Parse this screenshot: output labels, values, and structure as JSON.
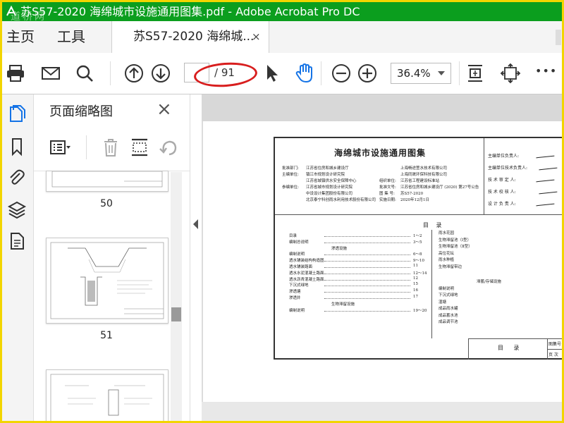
{
  "window": {
    "title": "苏S57-2020 海绵城市设施通用图集.pdf - Adobe Acrobat Pro DC",
    "watermark": "道桥网"
  },
  "tabs": {
    "home": "主页",
    "tools": "工具",
    "document": "苏S57-2020 海绵城...",
    "close": "×"
  },
  "toolbar": {
    "current_page": "",
    "page_count": "/ 91",
    "zoom": "36.4%",
    "more": "•••"
  },
  "thumbnail_panel": {
    "title": "页面缩略图",
    "close": "×",
    "thumbnails": [
      {
        "label": "50"
      },
      {
        "label": "51"
      }
    ]
  },
  "document_page": {
    "title": "海绵城市设施通用图集",
    "info_left": [
      {
        "k": "批准部门:",
        "v": "江苏省住房和城乡建设厅"
      },
      {
        "k": "主编单位:",
        "v": "镇江市规划设计研究院"
      },
      {
        "k": "",
        "v": "江苏省城镇供水安全保障中心"
      },
      {
        "k": "参编单位:",
        "v": "江苏省城市规划设计研究院"
      },
      {
        "k": "",
        "v": "中设设计集团股份有限公司"
      },
      {
        "k": "",
        "v": "北京泰宁科创雨水利用技术股份有限公司"
      }
    ],
    "info_mid": [
      {
        "k": "",
        "v": "上海畅途萱水技术有限公司"
      },
      {
        "k": "",
        "v": "上海同晟环保科技有限公司"
      },
      {
        "k": "组织单位:",
        "v": "江苏省工程建设标准站"
      },
      {
        "k": "批准文号:",
        "v": "江苏省住房和城乡建设厅 (2020) 第27号公告"
      },
      {
        "k": "图 集 号:",
        "v": "苏S57-2020"
      },
      {
        "k": "实施日期:",
        "v": "2020年12月1日"
      }
    ],
    "signatures": [
      "主编单位负责人:",
      "主编单位技术负责人:",
      "技 术 审 定 人:",
      "技 术 校 核 人:",
      "设 计 负 责 人:"
    ],
    "toc_heading": "目 录",
    "toc_left": [
      {
        "t": "目录",
        "p": "1～2"
      },
      {
        "t": "编制总说明",
        "p": "3～5"
      },
      {
        "t": "渗透设施",
        "p": ""
      },
      {
        "t": "编制说明",
        "p": "6～8"
      },
      {
        "t": "透水铺装结构构造图",
        "p": "9～10"
      },
      {
        "t": "透水铺装路面",
        "p": "11"
      },
      {
        "t": "透水水泥混凝土路面",
        "p": "12～14"
      },
      {
        "t": "透水沥青混凝土路面",
        "p": "12"
      },
      {
        "t": "下沉式绿地",
        "p": "15"
      },
      {
        "t": "渗透塘",
        "p": "16"
      },
      {
        "t": "渗透井",
        "p": "17"
      },
      {
        "t": "生物滞留设施",
        "p": ""
      },
      {
        "t": "编制说明",
        "p": "19～20"
      }
    ],
    "toc_right": [
      "雨水花园",
      "生物滞留池（Ⅰ型）",
      "生物滞留池（Ⅱ型）",
      "高位花坛",
      "雨水种植",
      "生物滞留带边",
      "滞蓄/存储设施",
      "编制说明",
      "下沉式绿地",
      "湿塘",
      "成品雨水罐",
      "成品蓄水池",
      "成品调节池"
    ],
    "footer_title": "目 录",
    "footer_cells": [
      "图集号",
      "页 次"
    ]
  },
  "colors": {
    "titlebar": "#0b9e1e",
    "accent_blue": "#1473e6",
    "annotation_red": "#d81e1e"
  }
}
